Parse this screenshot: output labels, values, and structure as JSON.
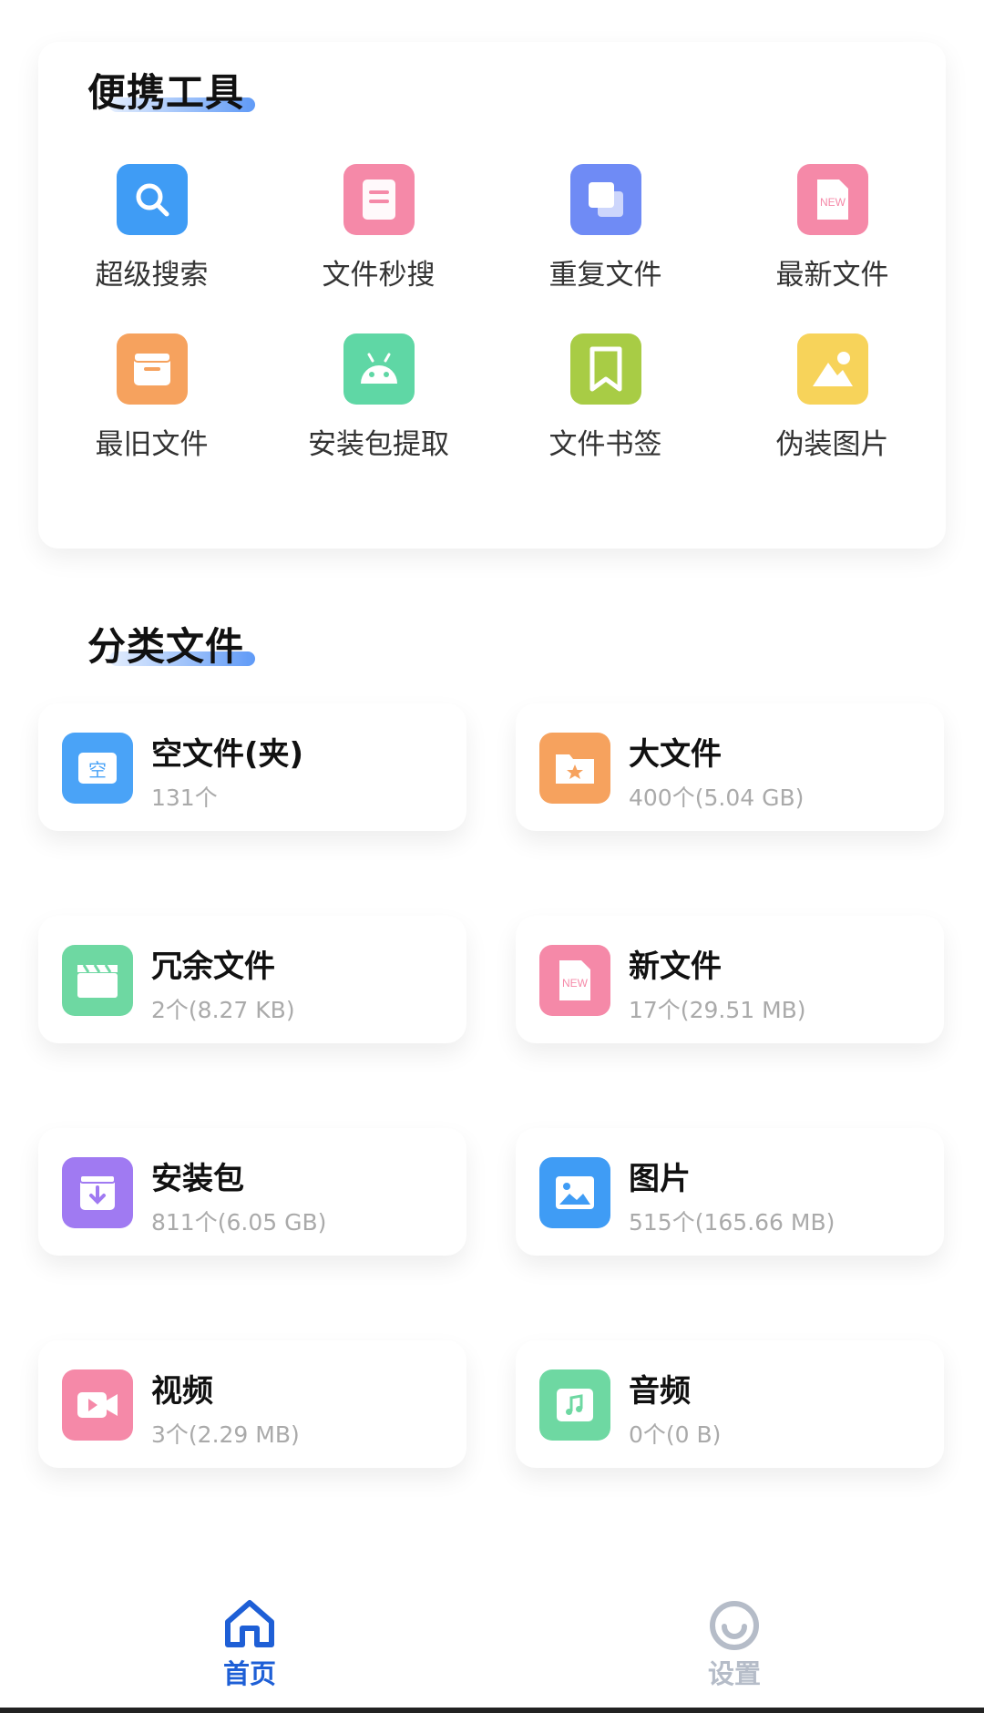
{
  "colors": {
    "accent": "#1e5fd6",
    "inactive": "#b5bcc8",
    "meta": "#aaaaaa"
  },
  "tools": {
    "title": "便携工具",
    "items": [
      {
        "label": "超级搜索",
        "icon": "search-icon",
        "color": "#3f9cf5"
      },
      {
        "label": "文件秒搜",
        "icon": "document-icon",
        "color": "#f589a8"
      },
      {
        "label": "重复文件",
        "icon": "duplicate-icon",
        "color": "#6f8bf5"
      },
      {
        "label": "最新文件",
        "icon": "new-file-icon",
        "color": "#f589a8"
      },
      {
        "label": "最旧文件",
        "icon": "archive-box-icon",
        "color": "#f6a25e"
      },
      {
        "label": "安装包提取",
        "icon": "android-icon",
        "color": "#5fd7a5"
      },
      {
        "label": "文件书签",
        "icon": "bookmark-icon",
        "color": "#a8cc45"
      },
      {
        "label": "伪装图片",
        "icon": "image-icon",
        "color": "#f7d35a"
      }
    ]
  },
  "categories": {
    "title": "分类文件",
    "items": [
      {
        "name": "空文件(夹)",
        "meta": "131个",
        "icon": "empty-folder-icon",
        "color": "#4aa3f7",
        "glyph": "空"
      },
      {
        "name": "大文件",
        "meta": "400个(5.04 GB)",
        "icon": "star-folder-icon",
        "color": "#f6a25e"
      },
      {
        "name": "冗余文件",
        "meta": "2个(8.27 KB)",
        "icon": "clapboard-icon",
        "color": "#6ed8a2"
      },
      {
        "name": "新文件",
        "meta": "17个(29.51 MB)",
        "icon": "new-file-icon",
        "color": "#f589a8"
      },
      {
        "name": "安装包",
        "meta": "811个(6.05 GB)",
        "icon": "package-download-icon",
        "color": "#a07af2"
      },
      {
        "name": "图片",
        "meta": "515个(165.66 MB)",
        "icon": "picture-icon",
        "color": "#3f9cf5"
      },
      {
        "name": "视频",
        "meta": "3个(2.29 MB)",
        "icon": "video-icon",
        "color": "#f589a8"
      },
      {
        "name": "音频",
        "meta": "0个(0 B)",
        "icon": "music-icon",
        "color": "#6ed8a2"
      }
    ]
  },
  "nav": {
    "home_label": "首页",
    "settings_label": "设置"
  }
}
